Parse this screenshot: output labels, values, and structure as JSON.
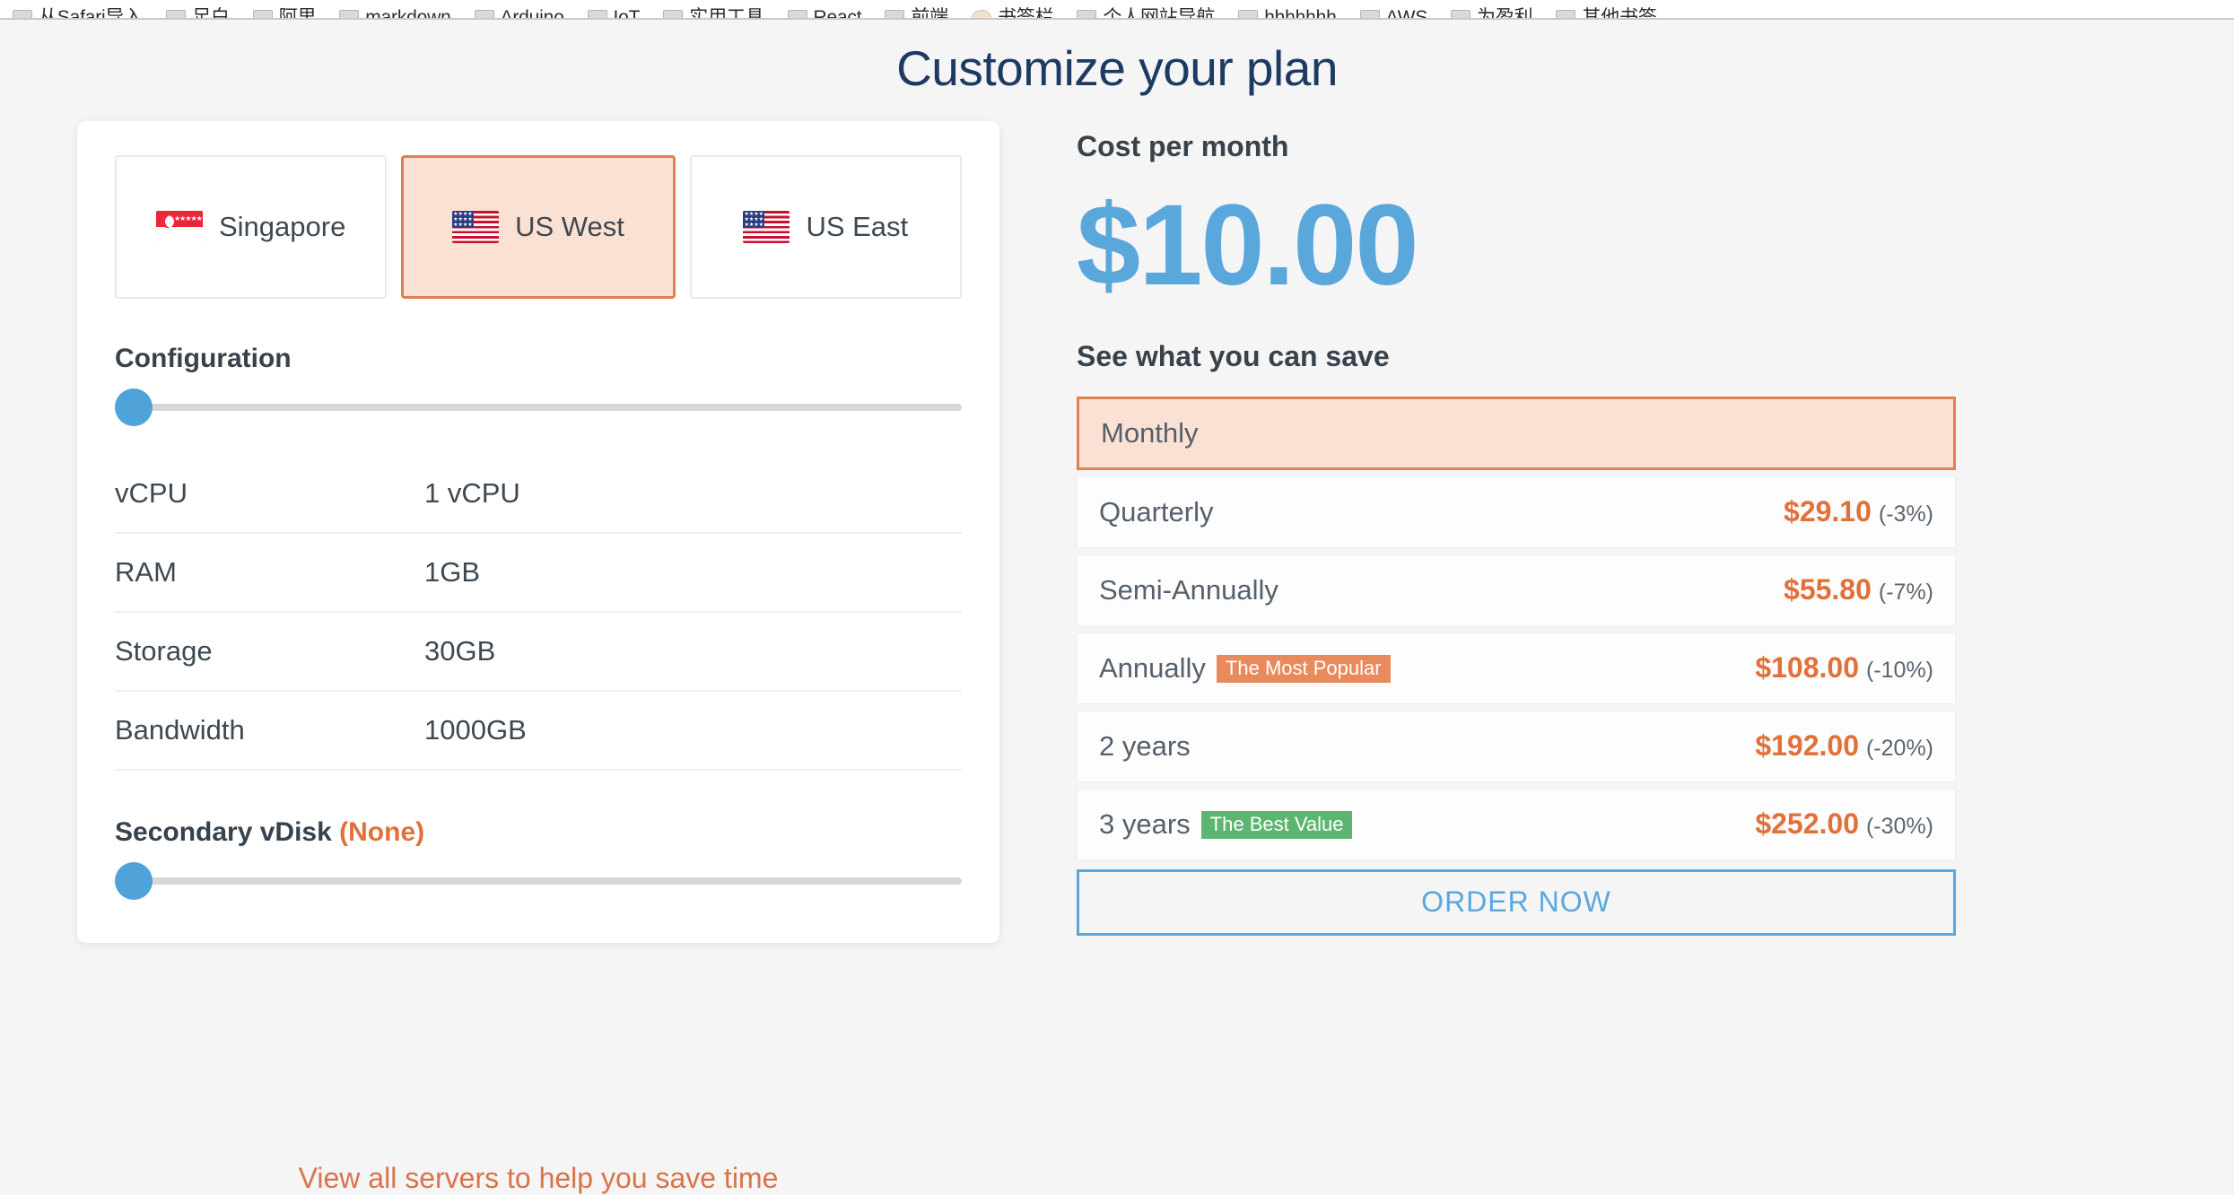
{
  "browser": {
    "bookmarks": [
      {
        "label": "从Safari导入",
        "icon": "bookmark-folder-icon"
      },
      {
        "label": "足白",
        "icon": "bookmark-folder-icon"
      },
      {
        "label": "阿里",
        "icon": "bookmark-folder-icon"
      },
      {
        "label": "markdown",
        "icon": "bookmark-folder-icon"
      },
      {
        "label": "Arduino",
        "icon": "bookmark-folder-icon"
      },
      {
        "label": "IoT",
        "icon": "bookmark-folder-icon"
      },
      {
        "label": "实用工具",
        "icon": "bookmark-folder-icon"
      },
      {
        "label": "React",
        "icon": "bookmark-folder-icon"
      },
      {
        "label": "前端",
        "icon": "bookmark-folder-icon"
      },
      {
        "label": "书签栏",
        "icon": "bookmark-page-icon"
      },
      {
        "label": "个人网站导航",
        "icon": "bookmark-folder-icon"
      },
      {
        "label": "hhhhhhh",
        "icon": "bookmark-folder-icon"
      },
      {
        "label": "AWS",
        "icon": "bookmark-folder-icon"
      },
      {
        "label": "为盈利",
        "icon": "bookmark-folder-icon"
      },
      {
        "label": "其他书签",
        "icon": "bookmark-folder-icon"
      }
    ]
  },
  "page": {
    "title": "Customize your plan",
    "bottom_link": "View all servers to help you save time"
  },
  "regions": {
    "items": [
      {
        "label": "Singapore",
        "flag": "flag-singapore-icon",
        "selected": false
      },
      {
        "label": "US West",
        "flag": "flag-usa-icon",
        "selected": true
      },
      {
        "label": "US East",
        "flag": "flag-usa-icon",
        "selected": false
      }
    ]
  },
  "configuration": {
    "heading": "Configuration",
    "slider_value": 0,
    "specs": [
      {
        "key": "vCPU",
        "value": "1 vCPU"
      },
      {
        "key": "RAM",
        "value": "1GB"
      },
      {
        "key": "Storage",
        "value": "30GB"
      },
      {
        "key": "Bandwidth",
        "value": "1000GB"
      }
    ]
  },
  "vdisk": {
    "heading": "Secondary vDisk",
    "value_label": "(None)",
    "slider_value": 0
  },
  "cost": {
    "label": "Cost per month",
    "amount": "$10.00"
  },
  "savings": {
    "heading": "See what you can save",
    "options": [
      {
        "term": "Monthly",
        "price": "",
        "discount": "",
        "badge": null,
        "selected": true
      },
      {
        "term": "Quarterly",
        "price": "$29.10",
        "discount": "(-3%)",
        "badge": null,
        "selected": false
      },
      {
        "term": "Semi-Annually",
        "price": "$55.80",
        "discount": "(-7%)",
        "badge": null,
        "selected": false
      },
      {
        "term": "Annually",
        "price": "$108.00",
        "discount": "(-10%)",
        "badge": {
          "text": "The Most Popular",
          "style": "popular"
        },
        "selected": false
      },
      {
        "term": "2 years",
        "price": "$192.00",
        "discount": "(-20%)",
        "badge": null,
        "selected": false
      },
      {
        "term": "3 years",
        "price": "$252.00",
        "discount": "(-30%)",
        "badge": {
          "text": "The Best Value",
          "style": "value"
        },
        "selected": false
      }
    ],
    "order_button": "ORDER NOW"
  },
  "colors": {
    "page_bg": "#f5f5f6",
    "title_navy": "#1c3a62",
    "accent_orange": "#e2703a",
    "selected_border": "#dd8052",
    "selected_fill": "#fbe1d3",
    "price_blue": "#5aa7dc",
    "slider_blue": "#4fa3d8",
    "badge_popular": "#e98a5c",
    "badge_value": "#5cb570",
    "text_slate": "#3d4852"
  }
}
